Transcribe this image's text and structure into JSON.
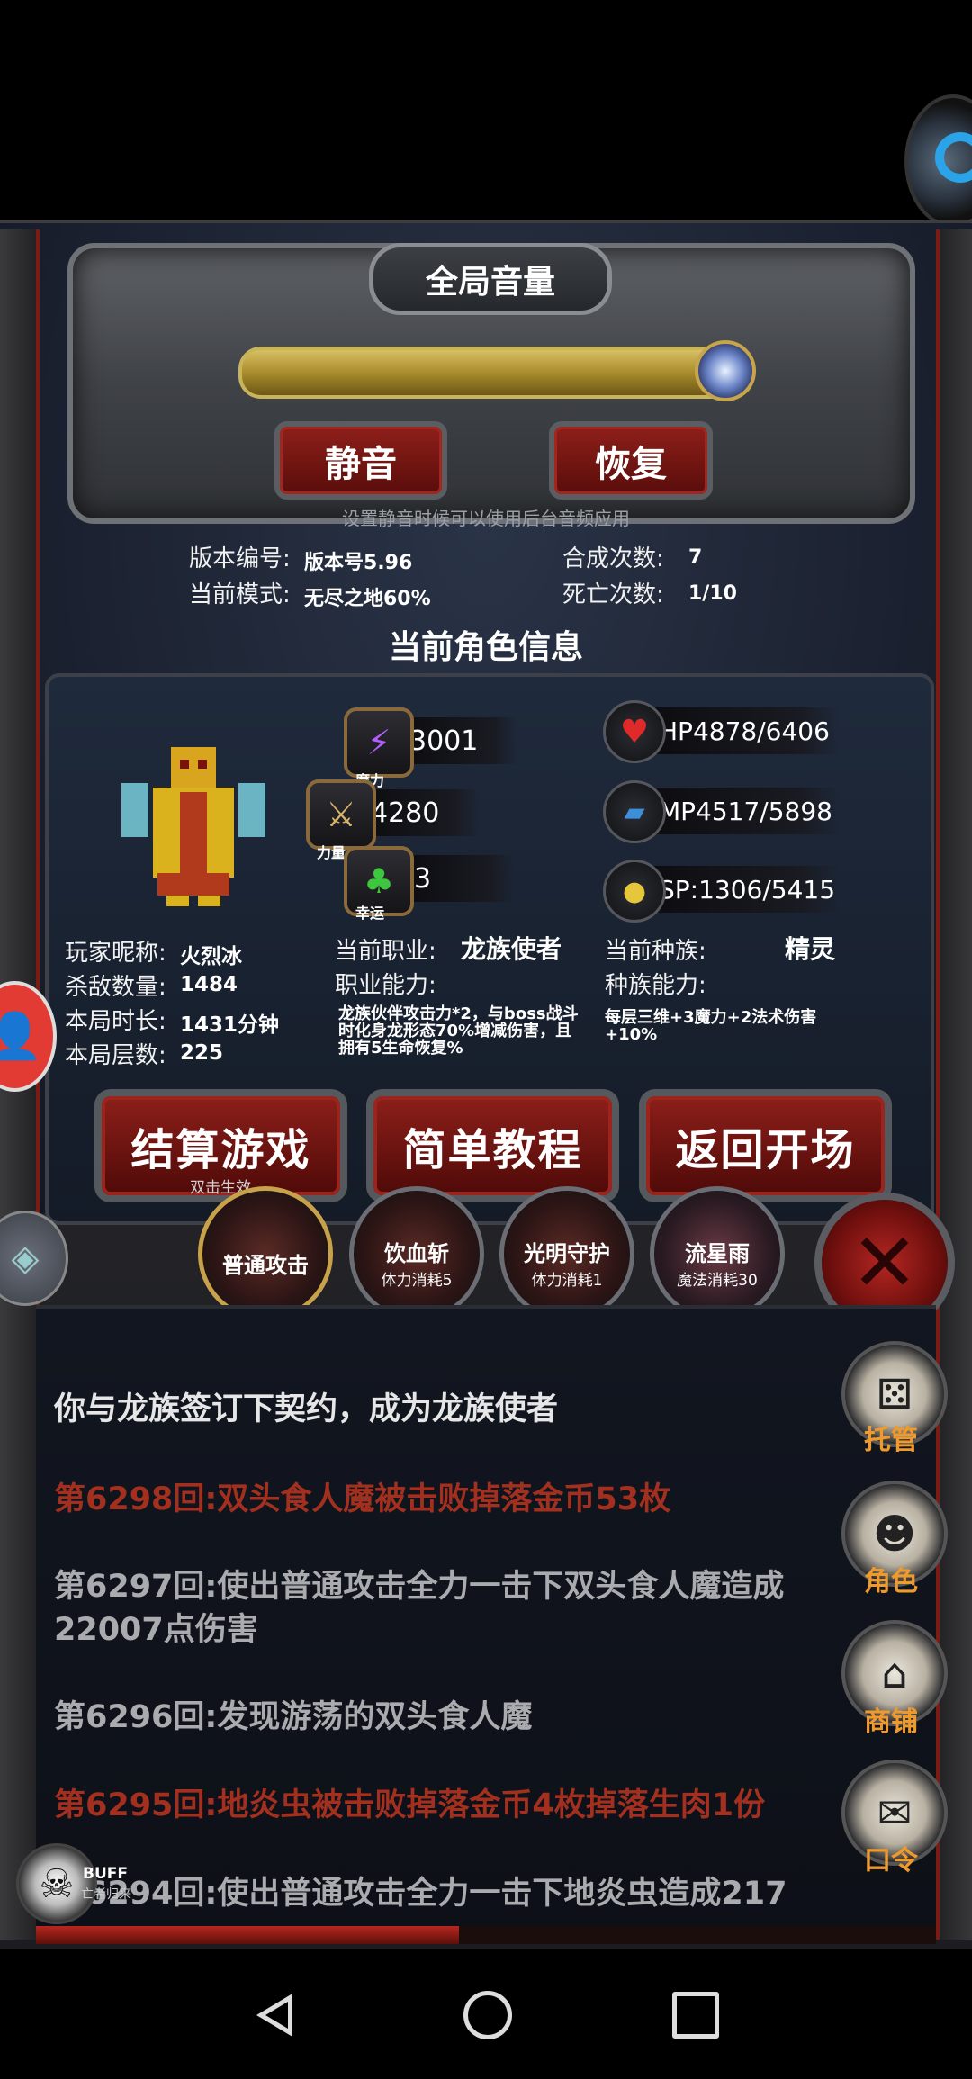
{
  "volume": {
    "title": "全局音量",
    "level": 0.95,
    "mute_label": "静音",
    "restore_label": "恢复",
    "hint": "设置静音时候可以使用后台音频应用"
  },
  "game_info": {
    "version_label": "版本编号:",
    "version_value": "版本号5.96",
    "mode_label": "当前模式:",
    "mode_value": "无尽之地60%",
    "synth_label": "合成次数:",
    "synth_value": "7",
    "death_label": "死亡次数:",
    "death_value": "1/10"
  },
  "character": {
    "section_title": "当前角色信息",
    "stats": {
      "magic_value": "3001",
      "magic_label": "魔力",
      "strength_value": "4280",
      "strength_label": "力量",
      "luck_value": "3",
      "luck_label": "幸运",
      "hp": "HP4878/6406",
      "mp": "MP4517/5898",
      "sp": "SP:1306/5415"
    },
    "nickname_label": "玩家昵称:",
    "nickname_value": "火烈冰",
    "kills_label": "杀敌数量:",
    "kills_value": "1484",
    "duration_label": "本局时长:",
    "duration_value": "1431分钟",
    "floor_label": "本局层数:",
    "floor_value": "225",
    "job_label": "当前职业:",
    "job_value": "龙族使者",
    "job_ability_label": "职业能力:",
    "job_ability_desc": "龙族伙伴攻击力*2，与boss战斗时化身龙形态70%增减伤害，且拥有5生命恢复%",
    "race_label": "当前种族:",
    "race_value": "精灵",
    "race_ability_label": "种族能力:",
    "race_ability_desc": "每层三维+3魔力+2法术伤害+10%"
  },
  "actions": {
    "settle_label": "结算游戏",
    "settle_sub": "双击生效",
    "tutorial_label": "简单教程",
    "return_label": "返回开场"
  },
  "skills": [
    {
      "name": "普通攻击",
      "cost": ""
    },
    {
      "name": "饮血斩",
      "cost": "体力消耗5"
    },
    {
      "name": "光明守护",
      "cost": "体力消耗1"
    },
    {
      "name": "流星雨",
      "cost": "魔法消耗30"
    }
  ],
  "log": [
    "你与龙族签订下契约，成为龙族使者",
    "第6298回:双头食人魔被击败掉落金币53枚",
    "第6297回:使出普通攻击全力一击下双头食人魔造成22007点伤害",
    "第6296回:发现游荡的双头食人魔",
    "第6295回:地炎虫被击败掉落金币4枚掉落生肉1份",
    "第6294回:使出普通攻击全力一击下地炎虫造成217"
  ],
  "side_menu": {
    "auto_label": "托管",
    "role_label": "角色",
    "shop_label": "商铺",
    "code_label": "口令"
  },
  "buff": {
    "label": "BUFF",
    "sub": "亡者归来"
  },
  "icons": {
    "magic": "lightning-icon",
    "strength": "sword-icon",
    "luck": "clover-icon",
    "hp": "heart-icon",
    "mp": "boot-icon",
    "sp": "muscle-icon"
  }
}
